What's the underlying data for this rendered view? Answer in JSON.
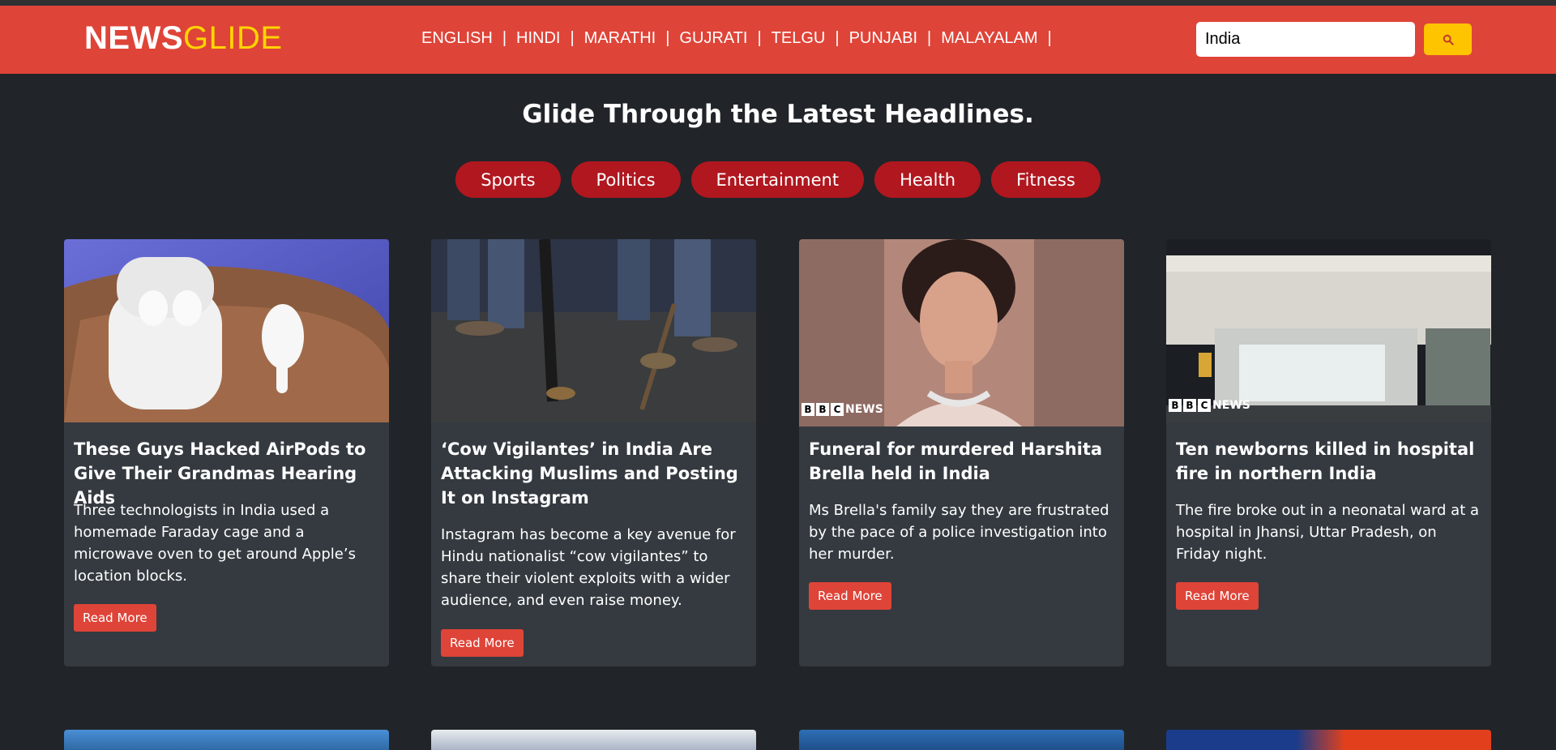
{
  "brand": {
    "part1": "NEWS",
    "part2": "GLIDE"
  },
  "languages": [
    "ENGLISH",
    "HINDI",
    "MARATHI",
    "GUJRATI",
    "TELGU",
    "PUNJABI",
    "MALAYALAM"
  ],
  "lang_separator": "|",
  "search": {
    "value": "India",
    "icon": "search-icon"
  },
  "headline": "Glide Through the Latest Headlines.",
  "categories": [
    "Sports",
    "Politics",
    "Entertainment",
    "Health",
    "Fitness"
  ],
  "cards": [
    {
      "title": "These Guys Hacked AirPods to Give Their Grandmas Hearing Aids",
      "description": "Three technologists in India used a homemade Faraday cage and a microwave oven to get around Apple’s location blocks.",
      "button": "Read More"
    },
    {
      "title": "‘Cow Vigilantes’ in India Are Attacking Muslims and Posting It on Instagram",
      "description": "Instagram has become a key avenue for Hindu nationalist “cow vigilantes” to share their violent exploits with a wider audience, and even raise money.",
      "button": "Read More"
    },
    {
      "title": "Funeral for murdered Harshita Brella held in India",
      "description": "Ms Brella's family say they are frustrated by the pace of a police investigation into her murder.",
      "button": "Read More",
      "image_logo": {
        "letters": [
          "B",
          "B",
          "C"
        ],
        "word": "NEWS"
      }
    },
    {
      "title": "Ten newborns killed in hospital fire in northern India",
      "description": "The fire broke out in a neonatal ward at a hospital in Jhansi, Uttar Pradesh, on Friday night.",
      "button": "Read More",
      "image_logo": {
        "letters": [
          "B",
          "B",
          "C"
        ],
        "word": "NEWS"
      }
    }
  ],
  "colors": {
    "navbar": "#df4438",
    "brand_accent": "#ffd400",
    "search_button": "#ffc400",
    "category_pill": "#b0171f",
    "page_bg": "#212529",
    "card_bg": "#343a40",
    "button": "#df4438"
  }
}
